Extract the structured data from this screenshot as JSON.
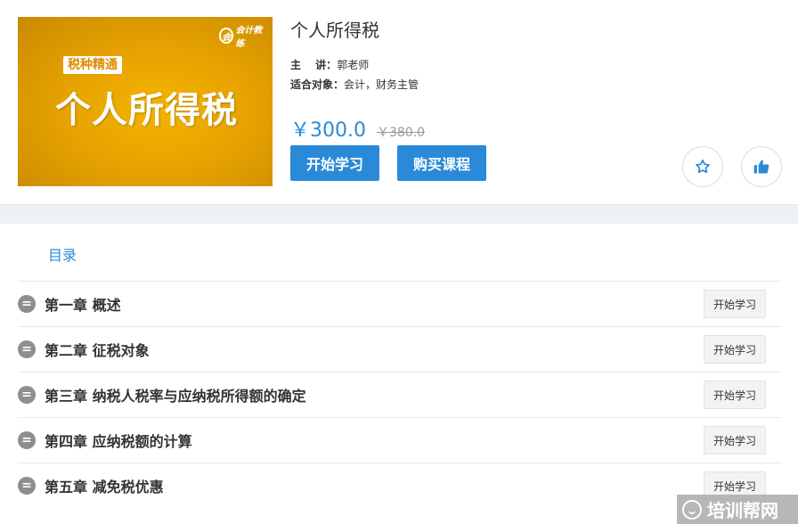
{
  "course": {
    "cover": {
      "logo_text": "会计教练",
      "tag": "税种精通",
      "title": "个人所得税"
    },
    "name": "个人所得税",
    "lecturer_label": "主　 讲：",
    "lecturer": "郭老师",
    "audience_label": "适合对象：",
    "audience": "会计，财务主管",
    "price": "￥300.0",
    "old_price": "￥380.0",
    "start_button": "开始学习",
    "buy_button": "购买课程",
    "icons": {
      "favorite": "star-icon",
      "like": "thumbs-up-icon"
    },
    "accent_color": "#2a8ad8"
  },
  "catalog": {
    "title": "目录",
    "bullet_glyph": "=",
    "chapters": [
      {
        "title": "第一章 概述",
        "action": "开始学习"
      },
      {
        "title": "第二章 征税对象",
        "action": "开始学习"
      },
      {
        "title": "第三章 纳税人税率与应纳税所得额的确定",
        "action": "开始学习"
      },
      {
        "title": "第四章 应纳税额的计算",
        "action": "开始学习"
      },
      {
        "title": "第五章 减免税优惠",
        "action": "开始学习"
      }
    ]
  },
  "watermark": {
    "text": "培训帮网"
  }
}
